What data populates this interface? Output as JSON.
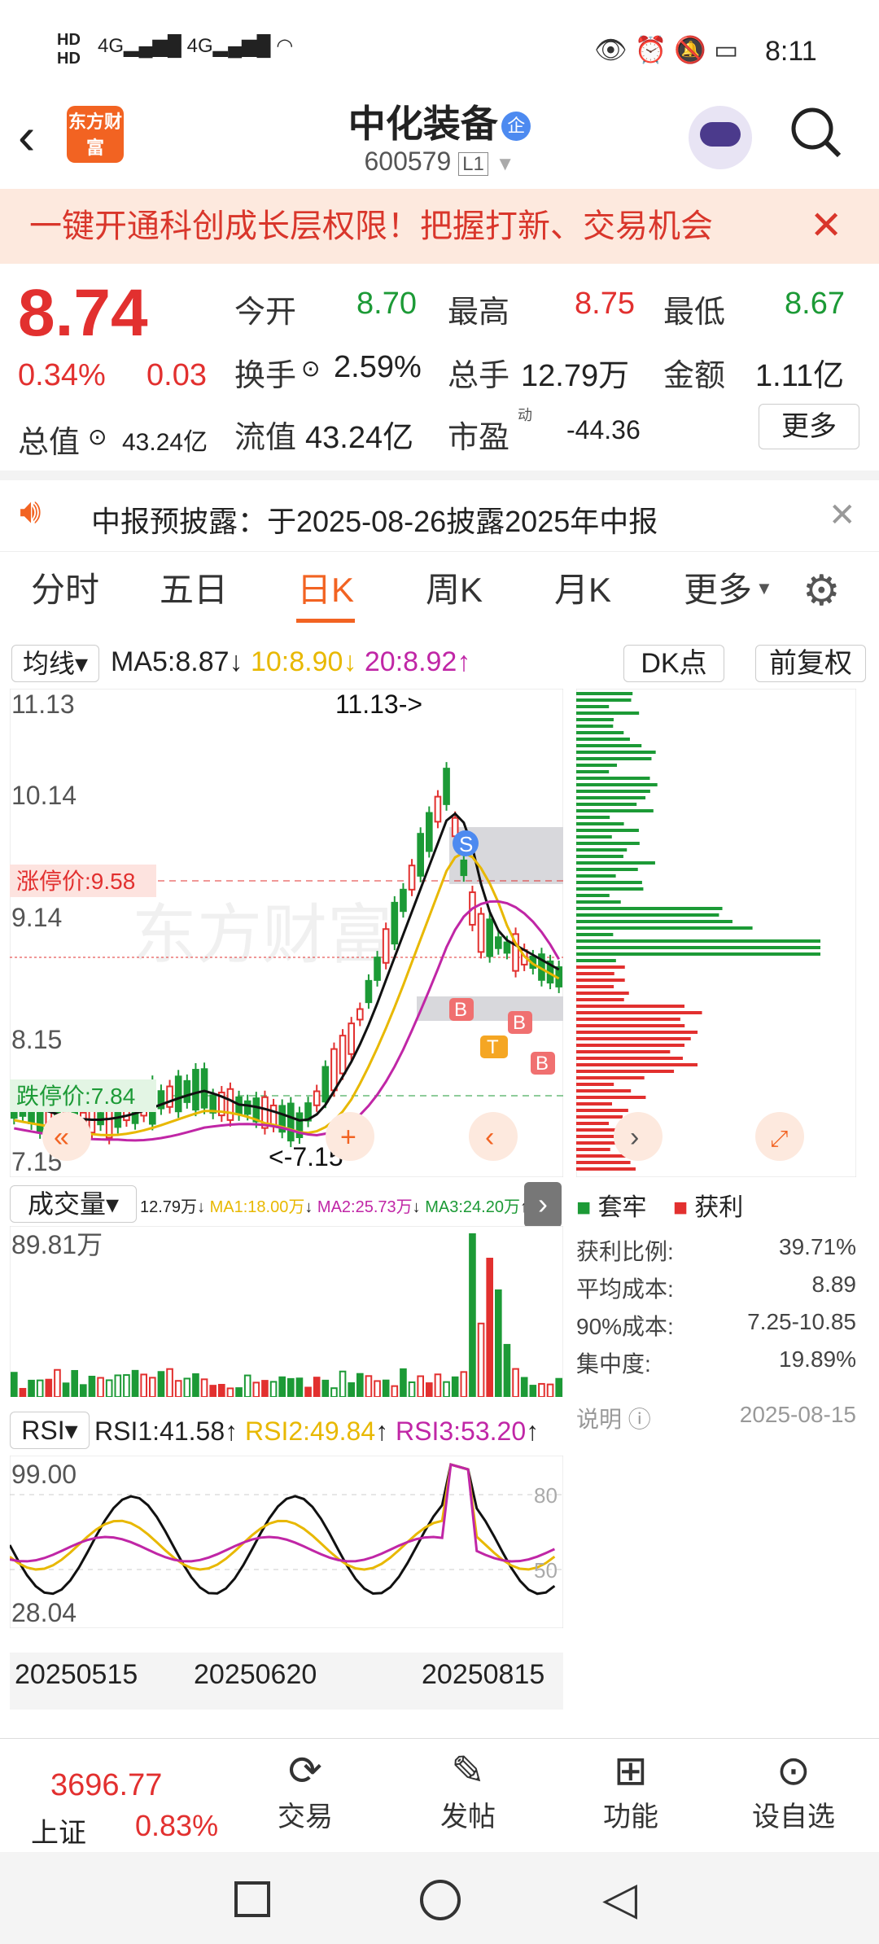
{
  "status": {
    "time": "8:11",
    "signal": "4G",
    "hd": "HD"
  },
  "header": {
    "logo": "东方财富",
    "name": "中化装备",
    "badge": "企",
    "code": "600579",
    "level": "L1"
  },
  "banner": {
    "text": "一键开通科创成长层权限！把握打新、交易机会"
  },
  "quote": {
    "price": "8.74",
    "pct": "0.34%",
    "chg": "0.03",
    "open_l": "今开",
    "open": "8.70",
    "high_l": "最高",
    "high": "8.75",
    "low_l": "最低",
    "low": "8.67",
    "turn_l": "换手",
    "turn": "2.59%",
    "vol_l": "总手",
    "vol": "12.79万",
    "amt_l": "金额",
    "amt": "1.11亿",
    "mcap_l": "总值",
    "mcap": "43.24亿",
    "flow_l": "流值",
    "flow": "43.24亿",
    "pe_l": "市盈",
    "pe_sup": "动",
    "pe": "-44.36",
    "more": "更多"
  },
  "notice": {
    "text": "中报预披露：于2025-08-26披露2025年中报"
  },
  "tabs": [
    "分时",
    "五日",
    "日K",
    "周K",
    "月K",
    "更多"
  ],
  "ma": {
    "sel": "均线",
    "ma5": "MA5:8.87",
    "ma10": "10:8.90",
    "ma20": "20:8.92",
    "dk": "DK点",
    "fq": "前复权"
  },
  "kline": {
    "y1": "11.13",
    "y2": "10.14",
    "y3": "9.14",
    "y4": "8.15",
    "y5": "7.15",
    "hi": "11.13->",
    "lo": "<-7.15",
    "zt": "涨停价:9.58",
    "dt": "跌停价:7.84",
    "wm": "东方财富"
  },
  "chip": {
    "tl": "套牢",
    "hl": "获利",
    "rows": [
      [
        "获利比例:",
        "39.71%"
      ],
      [
        "平均成本:",
        "8.89"
      ],
      [
        "90%成本:",
        "7.25-10.85"
      ],
      [
        "集中度:",
        "19.89%"
      ]
    ],
    "note": "说明",
    "date": "2025-08-15"
  },
  "volume": {
    "sel": "成交量",
    "v": "12.79万",
    "ma1": "MA1:18.00万",
    "ma2": "MA2:25.73万",
    "ma3": "MA3:24.20万",
    "max": "89.81万"
  },
  "rsi": {
    "sel": "RSI",
    "r1": "RSI1:41.58",
    "r2": "RSI2:49.84",
    "r3": "RSI3:53.20",
    "top": "99.00",
    "bot": "28.04",
    "l80": "80",
    "l50": "50"
  },
  "dates": [
    "20250515",
    "20250620",
    "20250815"
  ],
  "bottom": {
    "index": "3696.77",
    "iname": "上证",
    "ipct": "0.83%",
    "items": [
      "交易",
      "发帖",
      "功能",
      "设自选"
    ]
  },
  "colors": {
    "red": "#e2302f",
    "green": "#1c9a36",
    "accent": "#f26322"
  }
}
